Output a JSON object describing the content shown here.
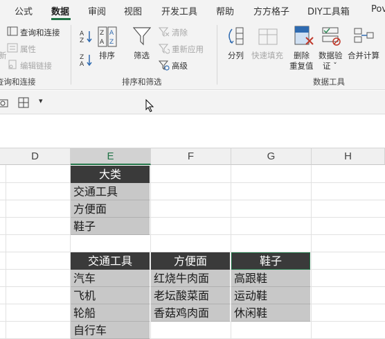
{
  "ribbon_tabs": [
    "公式",
    "数据",
    "审阅",
    "视图",
    "开发工具",
    "帮助",
    "方方格子",
    "DIY工具箱",
    "Pov"
  ],
  "active_tab": "数据",
  "ribbon": {
    "query": {
      "query_connect": "查询和连接",
      "properties": "属性",
      "edit_links": "编辑链接",
      "group_label": "查询和连接",
      "left_partial": "新"
    },
    "sort_filter": {
      "sort": "排序",
      "filter": "筛选",
      "clear": "清除",
      "reapply": "重新应用",
      "advanced": "高级",
      "group_label": "排序和筛选"
    },
    "data_tools": {
      "split": "分列",
      "flash_fill": "快速填充",
      "remove_dup_1": "删除",
      "remove_dup_2": "重复值",
      "validation_1": "数据验",
      "validation_2": "证 ˇ",
      "consolidate": "合并计算",
      "group_label": "数据工具"
    }
  },
  "qat": {
    "dropdown": "▾"
  },
  "columns": [
    "D",
    "E",
    "F",
    "G",
    "H"
  ],
  "selected_column": "E",
  "table1": {
    "header": "大类",
    "rows": [
      "交通工具",
      "方便面",
      "鞋子"
    ]
  },
  "table2": {
    "headers": [
      "交通工具",
      "方便面",
      "鞋子"
    ],
    "columns": [
      [
        "汽车",
        "飞机",
        "轮船",
        "自行车"
      ],
      [
        "红烧牛肉面",
        "老坛酸菜面",
        "香菇鸡肉面"
      ],
      [
        "高跟鞋",
        "运动鞋",
        "休闲鞋"
      ]
    ]
  },
  "colors": {
    "accent": "#217346",
    "header_bg": "#3a3a3a",
    "cell_bg": "#c8c8c8"
  }
}
